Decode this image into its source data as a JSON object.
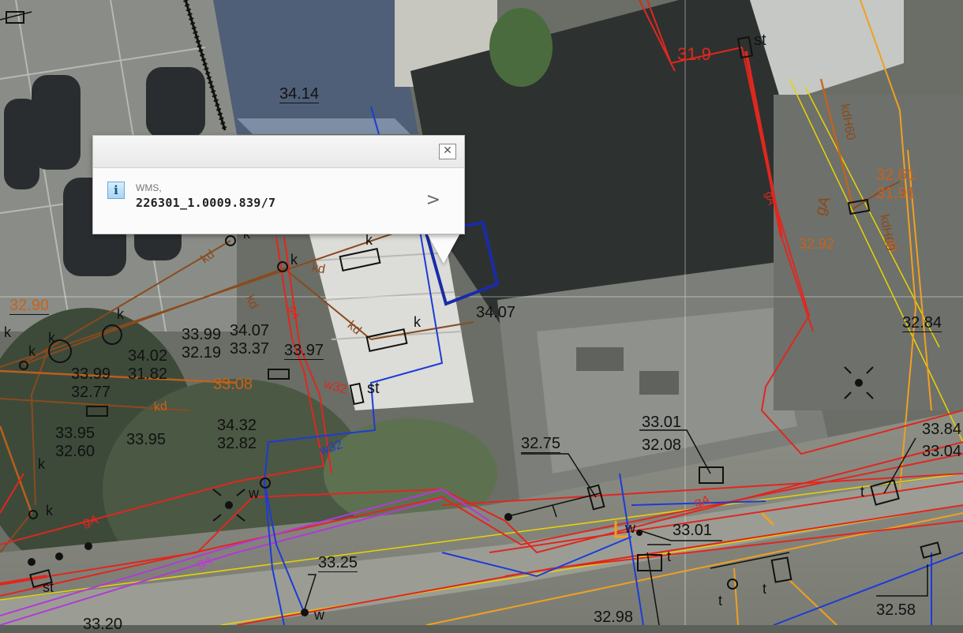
{
  "map": {
    "point_labels": [
      "34.14",
      "31.9",
      "st",
      "32.61",
      "31.91",
      "gA",
      "32.84",
      "32.90",
      "33.99",
      "32.19",
      "34.07",
      "33.37",
      "33.97",
      "34.02",
      "31.82",
      "33.99",
      "32.77",
      "33.08",
      "33.95",
      "32.60",
      "33.95",
      "34.32",
      "32.82",
      "34.07",
      "33.01",
      "32.08",
      "32.75",
      "33.84",
      "33.04",
      "33.01",
      "33.25",
      "32.98",
      "32.58",
      "33.20",
      "32.92",
      "st",
      "st",
      "k",
      "k",
      "k",
      "k",
      "k",
      "k",
      "k",
      "k",
      "k",
      "k",
      "w",
      "w",
      "w",
      "t",
      "t",
      "t",
      "t"
    ],
    "line_codes": [
      "kd",
      "kd",
      "kd",
      "kd",
      "gA",
      "gA",
      "kd",
      "w32",
      "w32",
      "kdH60",
      "kdH60",
      "gA",
      "gA",
      "gA",
      "gA"
    ]
  },
  "popup": {
    "layer_label": "WMS,",
    "feature_id": "226301_1.0009.839/7",
    "close_symbol": "✕",
    "more_symbol": ">",
    "info_symbol": "i"
  }
}
